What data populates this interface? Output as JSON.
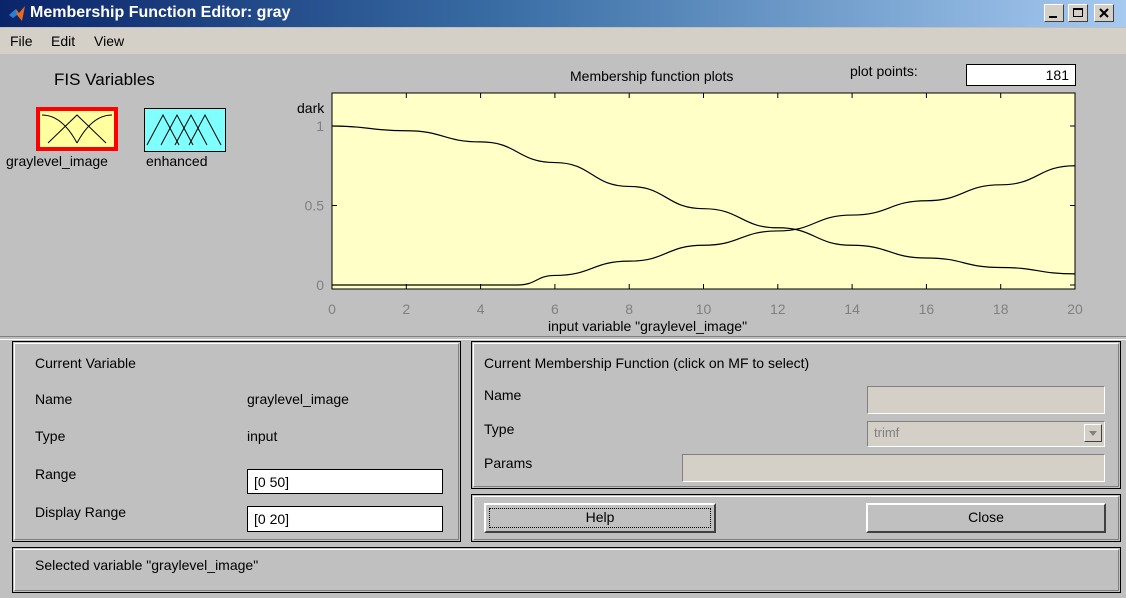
{
  "window": {
    "title": "Membership Function Editor: gray"
  },
  "menu": [
    "File",
    "Edit",
    "View"
  ],
  "fis": {
    "heading": "FIS Variables",
    "variables": [
      {
        "label": "graylevel_image",
        "selected": true,
        "color": "#ffffa0"
      },
      {
        "label": "enhanced",
        "selected": false,
        "color": "#80ffff"
      }
    ]
  },
  "plot": {
    "title": "Membership function plots",
    "plot_points_label": "plot points:",
    "plot_points": "181",
    "mf_label": "dark",
    "xlabel": "input variable \"graylevel_image\"",
    "background": "#ffffc8"
  },
  "chart_data": {
    "type": "line",
    "title": "Membership function plots",
    "xlabel": "input variable \"graylevel_image\"",
    "ylabel": "",
    "xlim": [
      0,
      20
    ],
    "ylim": [
      0,
      1
    ],
    "xticks": [
      0,
      2,
      4,
      6,
      8,
      10,
      12,
      14,
      16,
      18,
      20
    ],
    "yticks": [
      0,
      0.5,
      1
    ],
    "series": [
      {
        "name": "dark",
        "x": [
          0,
          2,
          4,
          6,
          8,
          10,
          12,
          14,
          16,
          18,
          20
        ],
        "y": [
          1.0,
          0.97,
          0.9,
          0.77,
          0.62,
          0.48,
          0.36,
          0.25,
          0.17,
          0.11,
          0.07
        ]
      },
      {
        "x": [
          0,
          4,
          5,
          6,
          8,
          10,
          12,
          14,
          16,
          18,
          20
        ],
        "y": [
          0,
          0,
          0,
          0.06,
          0.15,
          0.25,
          0.34,
          0.44,
          0.53,
          0.63,
          0.75
        ]
      }
    ]
  },
  "current_variable": {
    "heading": "Current Variable",
    "name_label": "Name",
    "name_value": "graylevel_image",
    "type_label": "Type",
    "type_value": "input",
    "range_label": "Range",
    "range_value": "[0 50]",
    "display_range_label": "Display Range",
    "display_range_value": "[0 20]"
  },
  "current_mf": {
    "heading": "Current Membership Function (click on MF to select)",
    "name_label": "Name",
    "name_value": "",
    "type_label": "Type",
    "type_value": "trimf",
    "params_label": "Params",
    "params_value": ""
  },
  "buttons": {
    "help": "Help",
    "close": "Close"
  },
  "status": "Selected variable \"graylevel_image\""
}
